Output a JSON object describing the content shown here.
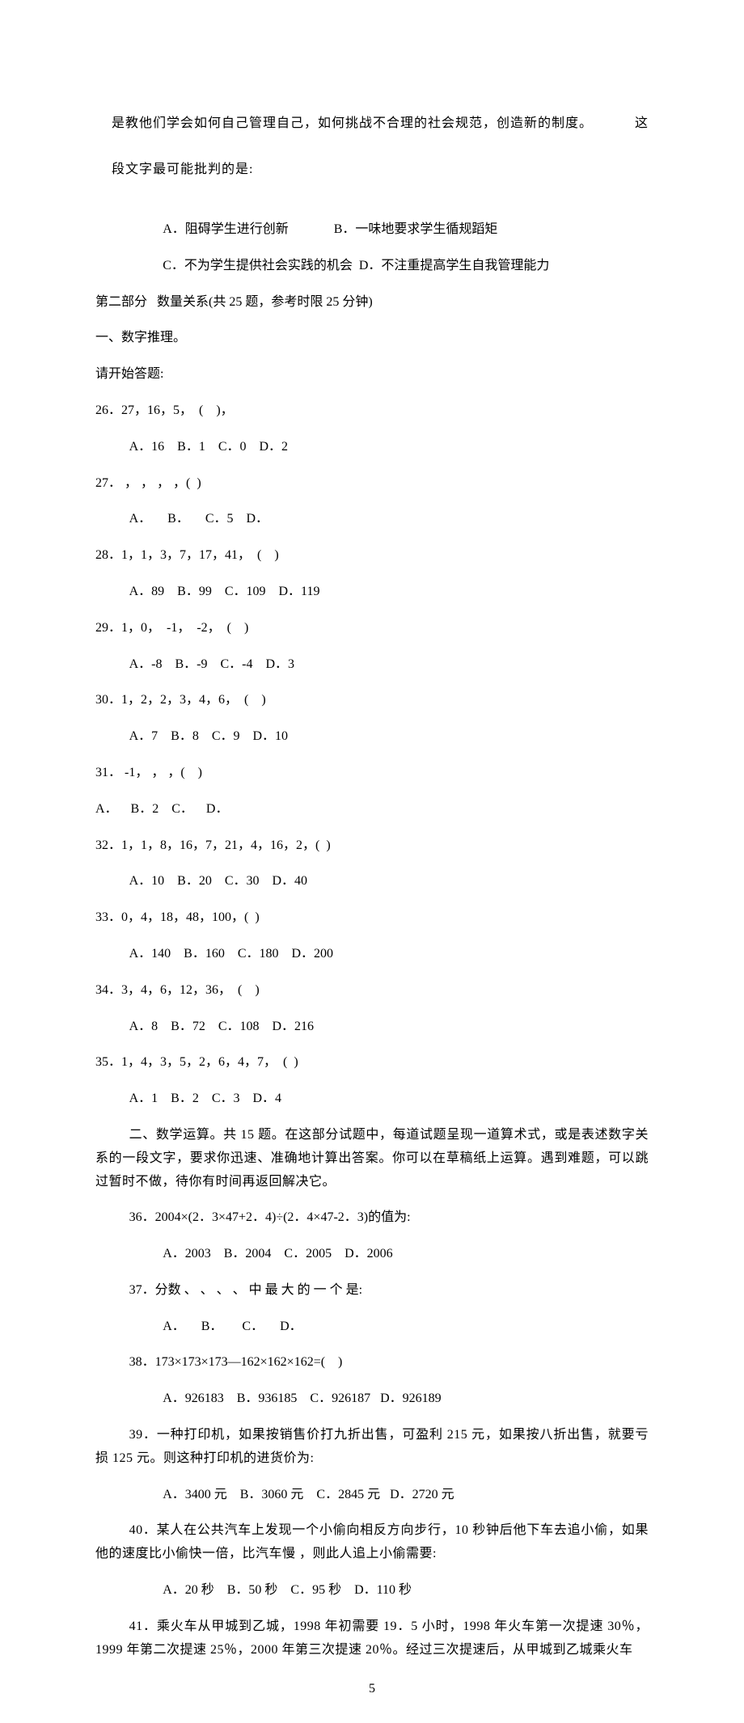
{
  "intro_para_line1": "是教他们学会如何自己管理自己，如何挑战不合理的社会规范，创造新的制度。",
  "intro_para_line1_right": "这",
  "intro_para_line2": "段文字最可能批判的是:",
  "intro_choices_1": "A．阻碍学生进行创新              B．一味地要求学生循规蹈矩",
  "intro_choices_2": "C．不为学生提供社会实践的机会  D．不注重提高学生自我管理能力",
  "part2_title": "第二部分   数量关系(共 25 题，参考时限 25 分钟)",
  "sec1_title": "一、数字推理。",
  "start_answer": "请开始答题:",
  "q26": "26．27，16，5，  (    )，",
  "q26_opts": "A．16    B．1    C．0    D．2",
  "q27": "27． ， ， ， ，(  )",
  "q27_opts": "A．     B．     C．5    D．",
  "q28": "28．1，1，3，7，17，41，  (    )",
  "q28_opts": "A．89    B．99    C．109    D．119",
  "q29": "29．1，0，  -1，  -2，  (    )",
  "q29_opts": "A．-8    B．-9    C．-4    D．3",
  "q30": "30．1，2，2，3，4，6，  (    )",
  "q30_opts": "A．7    B．8    C．9    D．10",
  "q31": "31． -1， ， ，(    )",
  "q31_opts_raw": "A．    B．2    C．    D．",
  "q32": "32．1，1，8，16，7，21，4，16，2，(  )",
  "q32_opts": "A．10    B．20    C．30    D．40",
  "q33": "33．0，4，18，48，100，(  )",
  "q33_opts": "A．140    B．160    C．180    D．200",
  "q34": "34．3，4，6，12，36，  (    )",
  "q34_opts": "A．8    B．72    C．108    D．216",
  "q35": "35．1，4，3，5，2，6，4，7，  (  )",
  "q35_opts": "A．1    B．2    C．3    D．4",
  "sec2_body": "二、数学运算。共 15 题。在这部分试题中，每道试题呈现一道算术式，或是表述数字关系的一段文字，要求你迅速、准确地计算出答案。你可以在草稿纸上运算。遇到难题，可以跳过暂时不做，待你有时间再返回解决它。",
  "q36": "36．2004×(2．3×47+2．4)÷(2．4×47-2．3)的值为:",
  "q36_opts": "A．2003    B．2004    C．2005    D．2006",
  "q37": "37．分数 、 、 、 、 中 最 大 的 一 个 是:",
  "q37_opts": "A．     B．      C．     D．",
  "q38": "38．173×173×173—162×162×162=(    )",
  "q38_opts": "A．926183    B．936185    C．926187   D．926189",
  "q39_body": "39．一种打印机，如果按销售价打九折出售，可盈利 215 元，如果按八折出售，就要亏损 125 元。则这种打印机的进货价为:",
  "q39_opts": "A．3400 元    B．3060 元    C．2845 元   D．2720 元",
  "q40_body": "40．某人在公共汽车上发现一个小偷向相反方向步行，10 秒钟后他下车去追小偷，如果他的速度比小偷快一倍，比汽车慢 ，则此人追上小偷需要:",
  "q40_opts": "A．20 秒    B．50 秒    C．95 秒    D．110 秒",
  "q41_body": "41．乘火车从甲城到乙城，1998 年初需要 19．5 小时，1998 年火车第一次提速 30％，1999 年第二次提速 25％，2000 年第三次提速 20％。经过三次提速后，从甲城到乙城乘火车",
  "page_number": "5"
}
